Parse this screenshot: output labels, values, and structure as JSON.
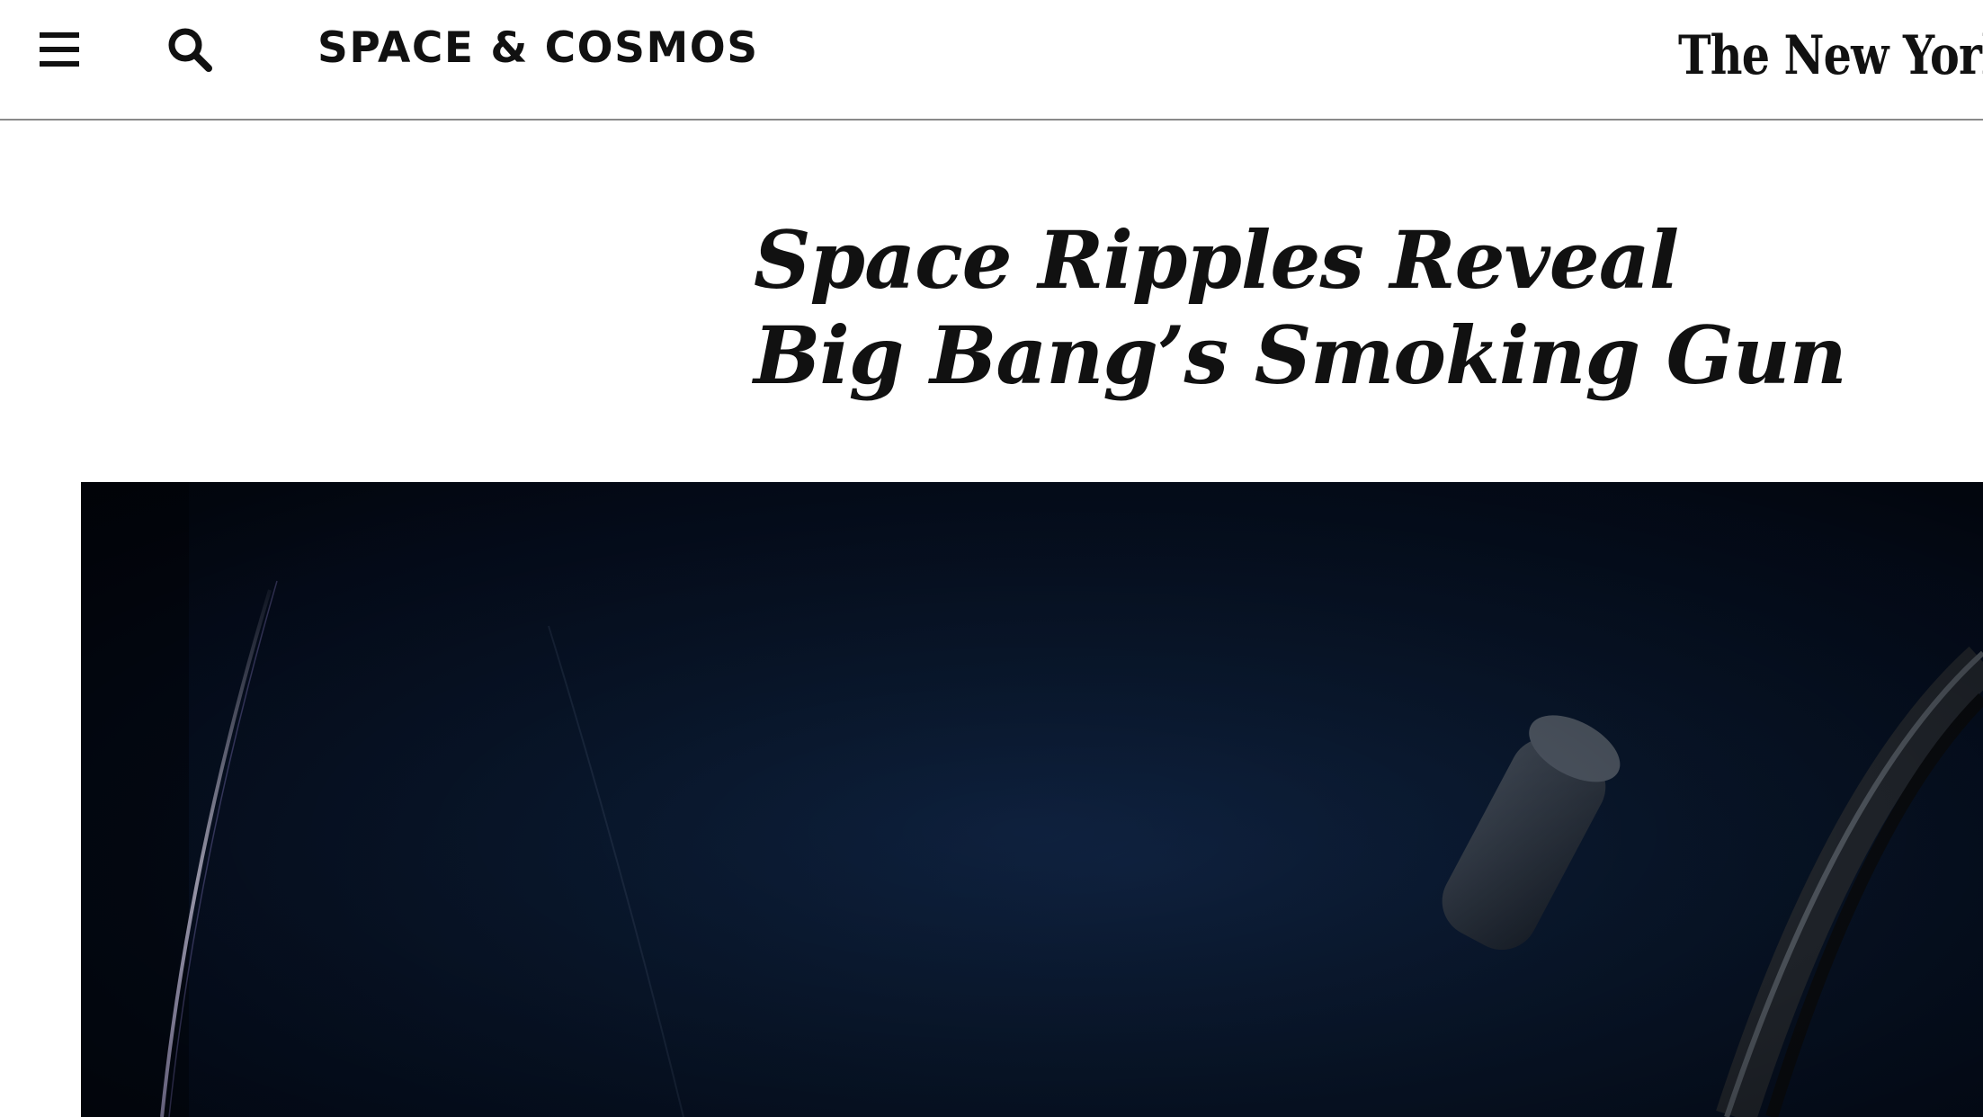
{
  "header": {
    "menu_icon": "hamburger-menu-icon",
    "search_icon": "search-icon",
    "section": "SPACE & COSMOS",
    "masthead": "The New York Times"
  },
  "article": {
    "headline_line1": "Space Ripples Reveal",
    "headline_line2": "Big Bang’s Smoking Gun"
  },
  "hero_image": {
    "subject": "telescope-image",
    "colors": {
      "background": "#061127",
      "highlight": "#c9c7e6"
    }
  }
}
